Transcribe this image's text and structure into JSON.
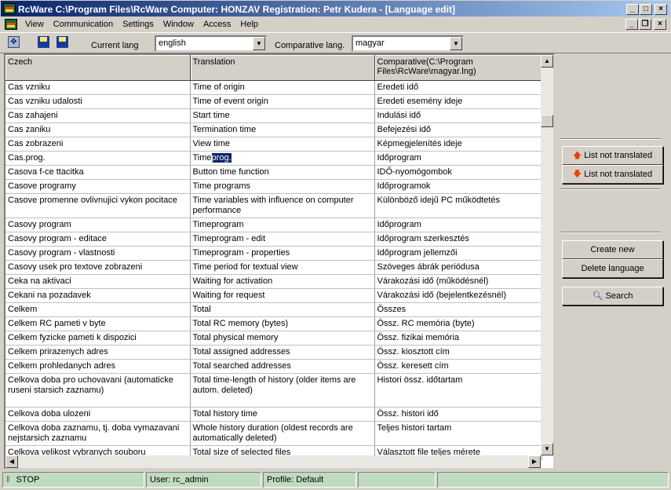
{
  "window": {
    "title": "RcWare C:\\Program Files\\RcWare  Computer: HONZAV  Registration: Petr Kudera - [Language edit]"
  },
  "menu": [
    "View",
    "Communication",
    "Settings",
    "Window",
    "Access",
    "Help"
  ],
  "toolbar": {
    "current_lang_label": "Current lang",
    "current_lang": "english",
    "comparative_label": "Comparative lang.",
    "comparative_lang": "magyar"
  },
  "grid": {
    "columns": [
      "Czech",
      "Translation",
      "Comparative(C:\\Program Files\\RcWare\\magyar.lng)"
    ],
    "rows": [
      {
        "czech": "Cas vzniku",
        "translation": "Time of origin",
        "comparative": "Eredeti idő"
      },
      {
        "czech": "Cas vzniku udalosti",
        "translation": "Time of event origin",
        "comparative": "Eredeti esemény ideje"
      },
      {
        "czech": "Cas zahajeni",
        "translation": "Start time",
        "comparative": "Indulási idő"
      },
      {
        "czech": "Cas zaniku",
        "translation": "Termination time",
        "comparative": "Befejezési idő"
      },
      {
        "czech": "Cas zobrazeni",
        "translation": "View time",
        "comparative": "Képmegjelenítés ideje"
      },
      {
        "czech": "Cas.prog.",
        "translation": "Time",
        "translation_selected": "prog.",
        "comparative": "Időprogram"
      },
      {
        "czech": "Casova f-ce ttacitka",
        "translation": "Button time function",
        "comparative": "IDŐ-nyomógombok"
      },
      {
        "czech": "Casove programy",
        "translation": "Time programs",
        "comparative": "Időprogramok"
      },
      {
        "czech": "Casove promenne ovlivnujici vykon pocitace",
        "translation": "Time variables with influence on computer performance",
        "comparative": "Különböző idejű PC működtetés",
        "lines": 2
      },
      {
        "czech": "Casovy program",
        "translation": "Timeprogram",
        "comparative": "Időprogram"
      },
      {
        "czech": "Casovy program - editace",
        "translation": "Timeprogram - edit",
        "comparative": "Időprogram szerkesztés"
      },
      {
        "czech": "Casovy program - vlastnosti",
        "translation": "Timeprogram - properties",
        "comparative": "Időprogram jellemzői"
      },
      {
        "czech": "Casovy usek pro textove zobrazeni",
        "translation": "Time period for textual view",
        "comparative": "Szöveges ábrák periódusa"
      },
      {
        "czech": "Ceka na aktivaci",
        "translation": "Waiting for activation",
        "comparative": "Várakozási idő (működésnél)"
      },
      {
        "czech": "Cekani na pozadavek",
        "translation": "Waiting for request",
        "comparative": "Várakozási idő (bejelentkezésnél)"
      },
      {
        "czech": "Celkem",
        "translation": "Total",
        "comparative": "Összes"
      },
      {
        "czech": "Celkem RC pameti v byte",
        "translation": "Total RC memory (bytes)",
        "comparative": "Össz. RC memória (byte)"
      },
      {
        "czech": "Celkem fyzicke pameti k dispozici",
        "translation": "Total physical memory",
        "comparative": "Össz. fizikai memória"
      },
      {
        "czech": "Celkem prirazenych adres",
        "translation": "Total assigned addresses",
        "comparative": "Össz. kiosztott cím"
      },
      {
        "czech": "Celkem prohledanych adres",
        "translation": "Total searched addresses",
        "comparative": "Össz. keresett cím"
      },
      {
        "czech": "Celkova doba pro uchovavani (automaticke ruseni starsich zaznamu)",
        "translation": "Total time-length of history (older items are autom. deleted)",
        "comparative": "Histori össz. időtartam",
        "lines": 3
      },
      {
        "czech": "Celkova doba ulozeni",
        "translation": "Total history time",
        "comparative": "Össz. histori idő"
      },
      {
        "czech": "Celkova doba zaznamu, tj. doba vymazavani nejstarsich zaznamu",
        "translation": "Whole history duration (oldest records are automatically deleted)",
        "comparative": "Teljes histori tartam",
        "lines": 2
      },
      {
        "czech": "Celkova velikost vybranych souboru",
        "translation": "Total size of selected files",
        "comparative": "Választott file teljes mérete"
      }
    ]
  },
  "panel": {
    "prev_not_translated": "List not translated",
    "next_not_translated": "List not translated",
    "create_new": "Create new",
    "delete_language": "Delete language",
    "search": "Search"
  },
  "status": {
    "state": "STOP",
    "user": "User: rc_admin",
    "profile": "Profile: Default"
  }
}
